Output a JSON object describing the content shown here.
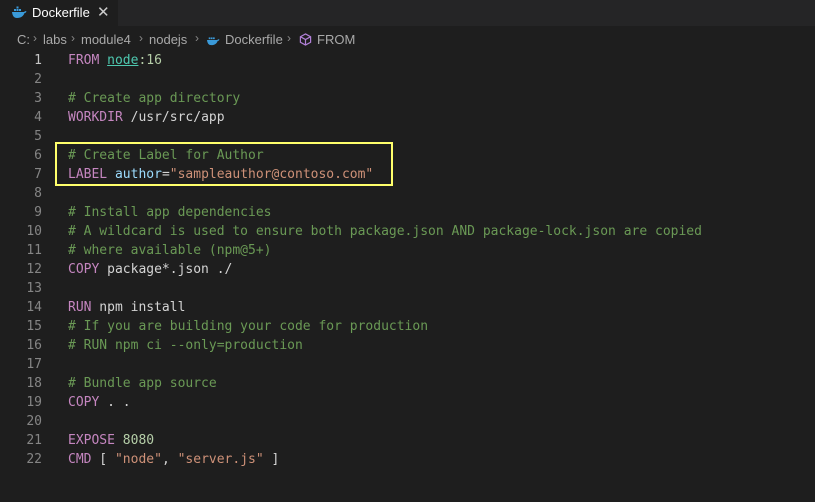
{
  "tab": {
    "title": "Dockerfile",
    "close_glyph": "✕",
    "icon": "docker-whale-icon"
  },
  "breadcrumb": {
    "items": [
      "C:",
      "labs",
      "module4",
      "nodejs",
      "Dockerfile",
      "FROM"
    ],
    "separator": "›"
  },
  "editor": {
    "lines": [
      {
        "n": "1",
        "tokens": [
          {
            "t": "FROM",
            "c": "kw"
          },
          {
            "t": " ",
            "c": "tx"
          },
          {
            "t": "node",
            "c": "img"
          },
          {
            "t": ":16",
            "c": "nm"
          }
        ]
      },
      {
        "n": "2",
        "tokens": []
      },
      {
        "n": "3",
        "tokens": [
          {
            "t": "# Create app directory",
            "c": "cm"
          }
        ]
      },
      {
        "n": "4",
        "tokens": [
          {
            "t": "WORKDIR",
            "c": "kw"
          },
          {
            "t": " /usr/src/app",
            "c": "tx"
          }
        ]
      },
      {
        "n": "5",
        "tokens": []
      },
      {
        "n": "6",
        "tokens": [
          {
            "t": "# Create Label for Author",
            "c": "cm"
          }
        ]
      },
      {
        "n": "7",
        "tokens": [
          {
            "t": "LABEL",
            "c": "kw"
          },
          {
            "t": " ",
            "c": "tx"
          },
          {
            "t": "author",
            "c": "vr"
          },
          {
            "t": "=",
            "c": "tx"
          },
          {
            "t": "\"sampleauthor@contoso.com\"",
            "c": "st"
          }
        ]
      },
      {
        "n": "8",
        "tokens": []
      },
      {
        "n": "9",
        "tokens": [
          {
            "t": "# Install app dependencies",
            "c": "cm"
          }
        ]
      },
      {
        "n": "10",
        "tokens": [
          {
            "t": "# A wildcard is used to ensure both package.json AND package-lock.json are copied",
            "c": "cm"
          }
        ]
      },
      {
        "n": "11",
        "tokens": [
          {
            "t": "# where available (npm@5+)",
            "c": "cm"
          }
        ]
      },
      {
        "n": "12",
        "tokens": [
          {
            "t": "COPY",
            "c": "kw"
          },
          {
            "t": " package*.json ./",
            "c": "tx"
          }
        ]
      },
      {
        "n": "13",
        "tokens": []
      },
      {
        "n": "14",
        "tokens": [
          {
            "t": "RUN",
            "c": "kw"
          },
          {
            "t": " npm install",
            "c": "tx"
          }
        ]
      },
      {
        "n": "15",
        "tokens": [
          {
            "t": "# If you are building your code for production",
            "c": "cm"
          }
        ]
      },
      {
        "n": "16",
        "tokens": [
          {
            "t": "# RUN npm ci --only=production",
            "c": "cm"
          }
        ]
      },
      {
        "n": "17",
        "tokens": []
      },
      {
        "n": "18",
        "tokens": [
          {
            "t": "# Bundle app source",
            "c": "cm"
          }
        ]
      },
      {
        "n": "19",
        "tokens": [
          {
            "t": "COPY",
            "c": "kw"
          },
          {
            "t": " . .",
            "c": "tx"
          }
        ]
      },
      {
        "n": "20",
        "tokens": []
      },
      {
        "n": "21",
        "tokens": [
          {
            "t": "EXPOSE",
            "c": "kw"
          },
          {
            "t": " ",
            "c": "tx"
          },
          {
            "t": "8080",
            "c": "nm"
          }
        ]
      },
      {
        "n": "22",
        "tokens": [
          {
            "t": "CMD",
            "c": "kw"
          },
          {
            "t": " [ ",
            "c": "tx"
          },
          {
            "t": "\"node\"",
            "c": "st"
          },
          {
            "t": ", ",
            "c": "tx"
          },
          {
            "t": "\"server.js\"",
            "c": "st"
          },
          {
            "t": " ]",
            "c": "tx"
          }
        ]
      }
    ]
  },
  "colors": {
    "background": "#1e1e1e",
    "keyword": "#c586c0",
    "comment": "#6a9955",
    "string": "#ce9178",
    "highlight_border": "#ffff6b"
  }
}
